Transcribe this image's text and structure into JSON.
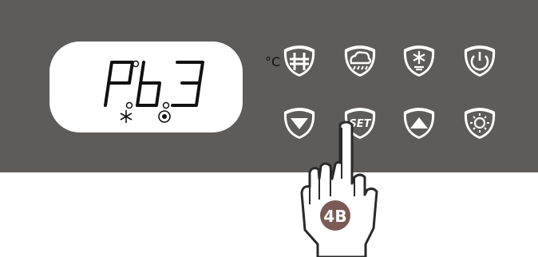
{
  "display": {
    "readout": "Pb.3",
    "unit": "°C",
    "indicators": [
      "snowflake-icon",
      "fan-icon"
    ]
  },
  "buttons_top": [
    {
      "icon": "defrost-icon"
    },
    {
      "icon": "rain-cloud-icon"
    },
    {
      "icon": "snowflake-drip-icon"
    },
    {
      "icon": "power-icon"
    }
  ],
  "buttons_bottom": [
    {
      "icon": "arrow-down-icon"
    },
    {
      "icon": "set-icon",
      "label": "SET"
    },
    {
      "icon": "arrow-up-icon"
    },
    {
      "icon": "light-icon"
    }
  ],
  "callout": {
    "label": "4B",
    "badge_color": "#7b5a55"
  },
  "colors": {
    "panel": "#5d5c5b",
    "display_bg": "#ffffff",
    "segment": "#111111"
  }
}
